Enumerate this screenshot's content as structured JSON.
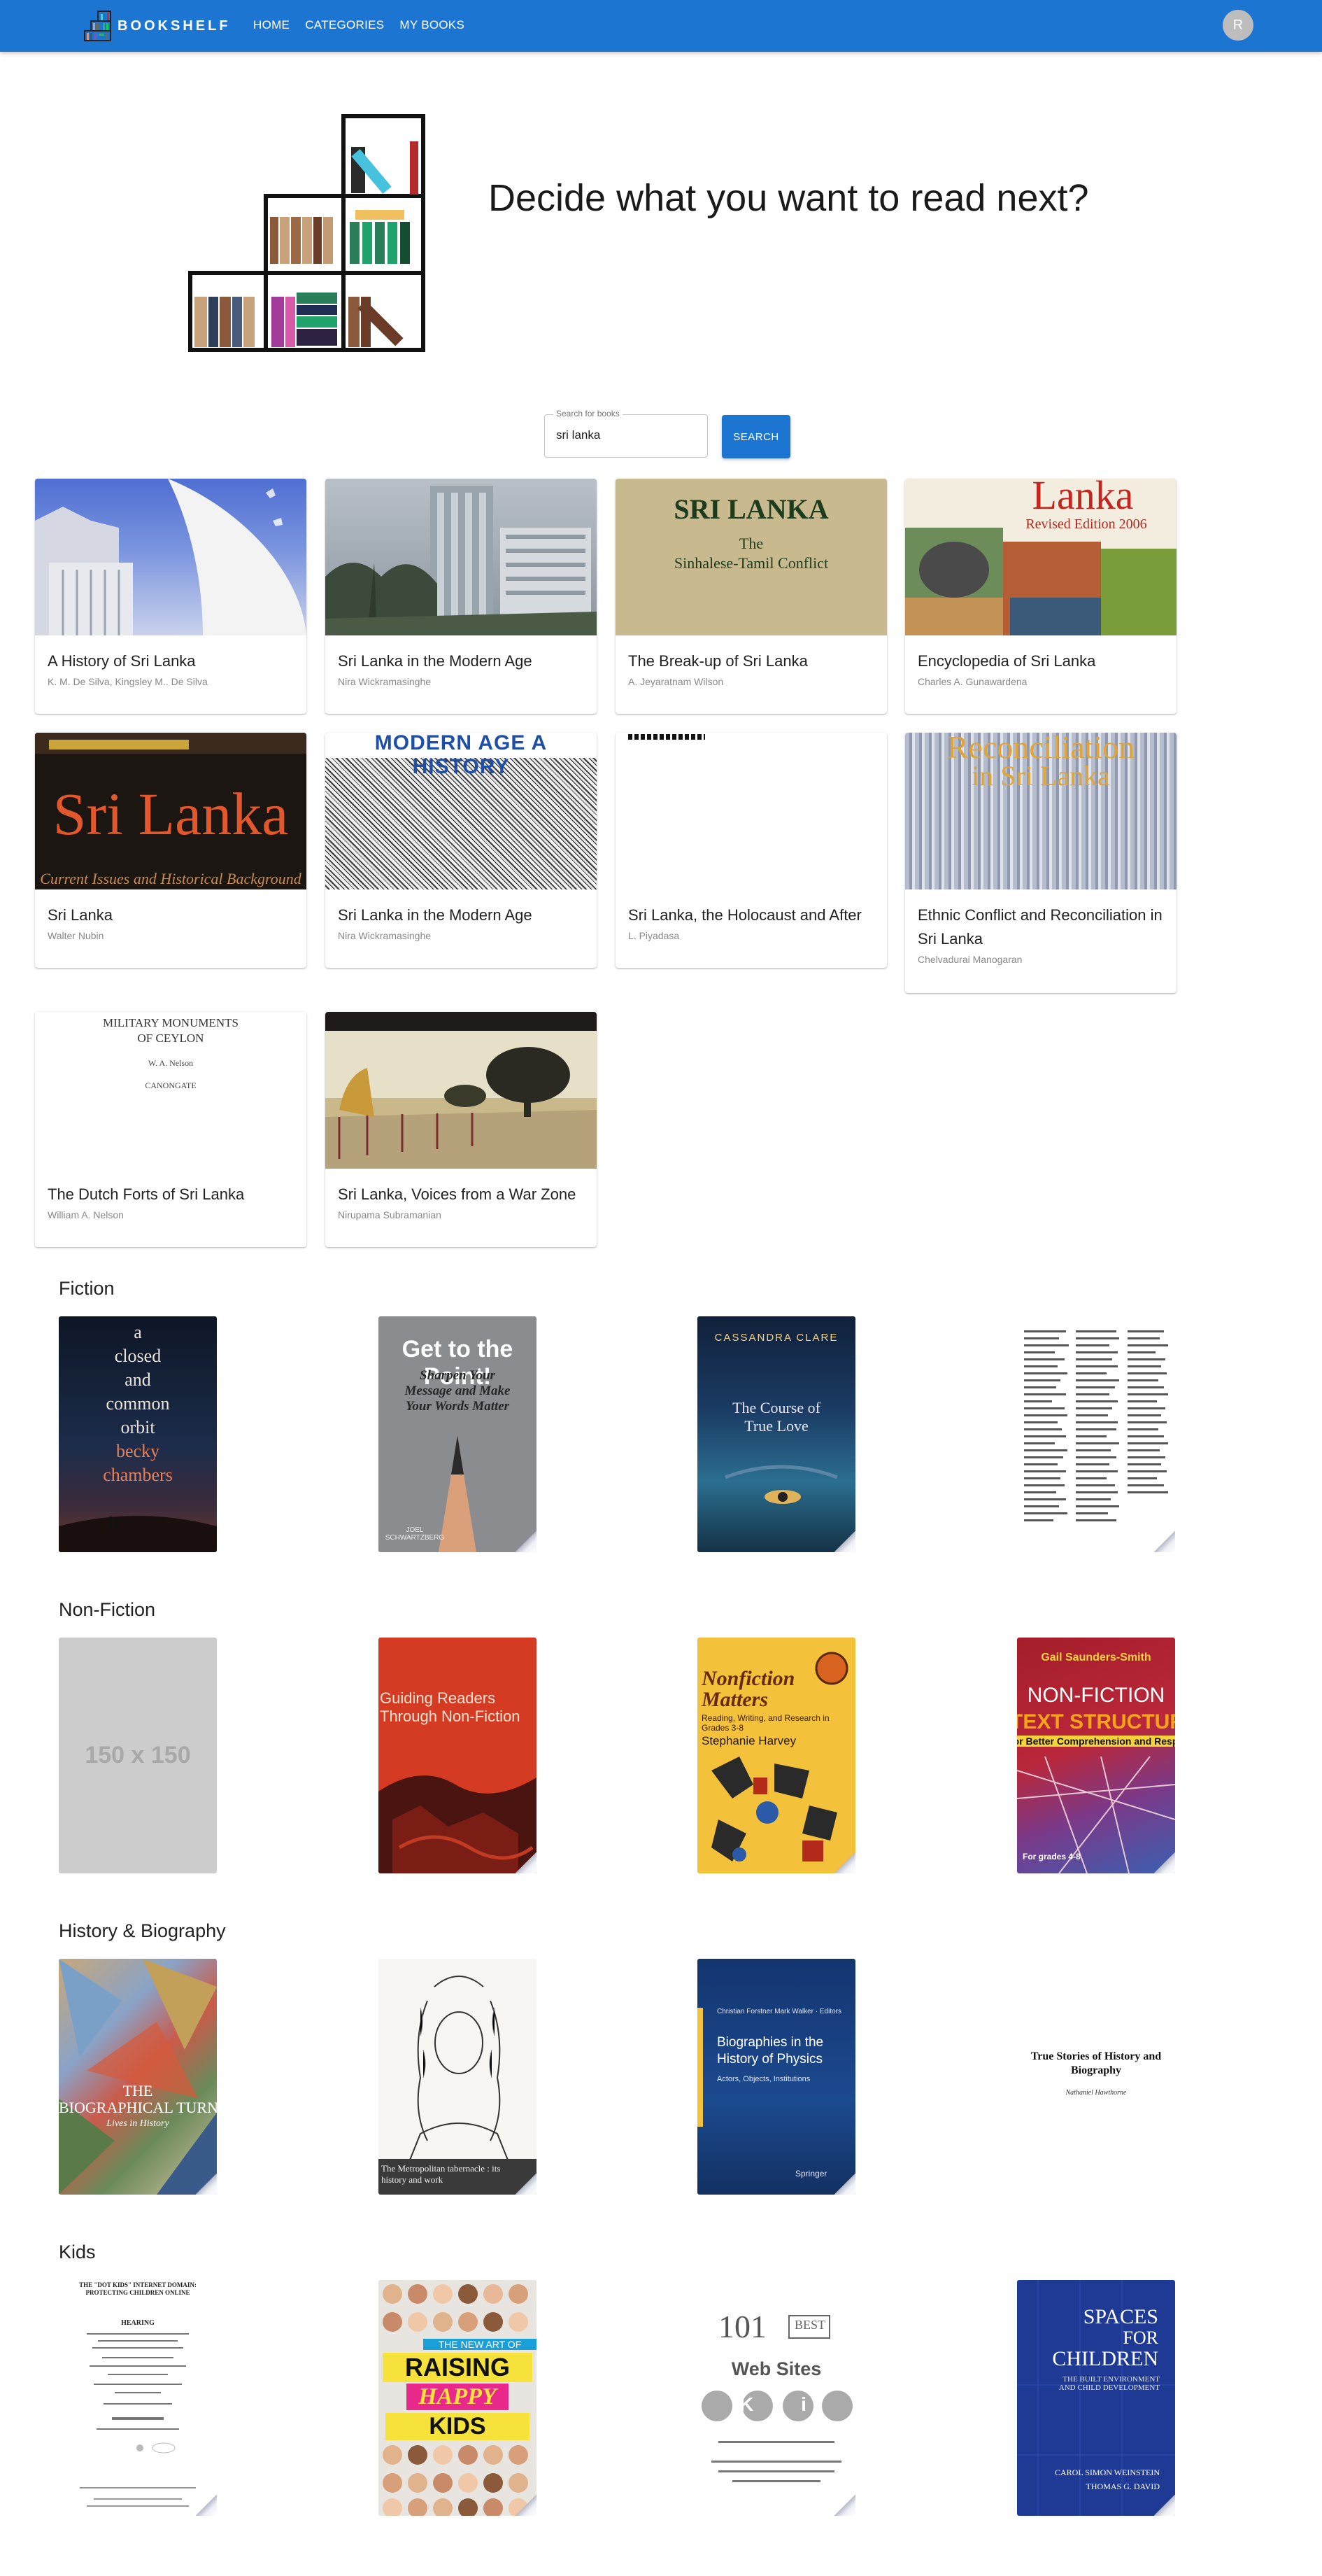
{
  "app": {
    "brand": "BOOKSHELF",
    "nav": [
      "HOME",
      "CATEGORIES",
      "MY BOOKS"
    ],
    "avatar_letter": "R",
    "accent_color": "#1d75d2"
  },
  "hero": {
    "title": "Decide what you want to read next?"
  },
  "search": {
    "label": "Search for books",
    "value": "sri lanka",
    "button": "SEARCH"
  },
  "results": [
    {
      "title": "A History of Sri Lanka",
      "author": "K. M. De Silva, Kingsley M.. De Silva"
    },
    {
      "title": "Sri Lanka in the Modern Age",
      "author": "Nira Wickramasinghe"
    },
    {
      "title": "The Break-up of Sri Lanka",
      "author": "A. Jeyaratnam Wilson",
      "cover_text": [
        "SRI LANKA",
        "The",
        "Sinhalese-Tamil Conflict"
      ]
    },
    {
      "title": "Encyclopedia of Sri Lanka",
      "author": "Charles A. Gunawardena",
      "cover_text": [
        "Lanka",
        "Revised Edition 2006"
      ]
    },
    {
      "title": "Sri Lanka",
      "author": "Walter Nubin",
      "cover_text": [
        "Sri Lanka",
        "Current Issues and Historical Background"
      ]
    },
    {
      "title": "Sri Lanka in the Modern Age",
      "author": "Nira Wickramasinghe",
      "cover_text": [
        "MODERN AGE A HISTORY"
      ]
    },
    {
      "title": "Sri Lanka, the Holocaust and After",
      "author": "L. Piyadasa"
    },
    {
      "title": "Ethnic Conflict and Reconciliation in Sri Lanka",
      "author": "Chelvadurai Manogaran",
      "cover_text": [
        "Reconciliation",
        "in Sri Lanka"
      ]
    },
    {
      "title": "The Dutch Forts of Sri Lanka",
      "author": "William A. Nelson",
      "cover_text": [
        "MILITARY MONUMENTS",
        "OF CEYLON",
        "W. A. Nelson",
        "CANONGATE"
      ]
    },
    {
      "title": "Sri Lanka, Voices from a War Zone",
      "author": "Nirupama Subramanian"
    }
  ],
  "sections": [
    {
      "title": "Fiction",
      "books": [
        {
          "cover_text": [
            "a",
            "closed",
            "and",
            "common",
            "orbit",
            "becky",
            "chambers"
          ]
        },
        {
          "cover_text": [
            "Get to the Point!",
            "Sharpen Your Message and Make Your Words Matter",
            "JOEL SCHWARTZBERG"
          ]
        },
        {
          "cover_text": [
            "CASSANDRA CLARE",
            "The Course of True Love"
          ]
        },
        {
          "cover_text": []
        }
      ]
    },
    {
      "title": "Non-Fiction",
      "books": [
        {
          "cover_text": [
            "150 x 150"
          ]
        },
        {
          "cover_text": [
            "Guiding Readers Through Non-Fiction"
          ]
        },
        {
          "cover_text": [
            "Nonfiction Matters",
            "Reading, Writing, and Research in Grades 3-8",
            "Stephanie Harvey"
          ]
        },
        {
          "cover_text": [
            "Gail Saunders-Smith",
            "NON-FICTION",
            "TEXT STRUCTURES",
            "for Better Comprehension and Response",
            "For grades 4-8"
          ]
        }
      ]
    },
    {
      "title": "History & Biography",
      "books": [
        {
          "cover_text": [
            "THE",
            "BIOGRAPHICAL TURN",
            "Lives in History"
          ]
        },
        {
          "cover_text": [
            "The Metropolitan tabernacle : its history and work"
          ]
        },
        {
          "cover_text": [
            "Christian Forstner  Mark Walker · Editors",
            "Biographies in the History of Physics",
            "Actors, Objects, Institutions",
            "Springer"
          ]
        },
        {
          "cover_text": [
            "True Stories of History and Biography",
            "Nathaniel Hawthorne"
          ]
        }
      ]
    },
    {
      "title": "Kids",
      "books": [
        {
          "cover_text": [
            "THE \"DOT KIDS\" INTERNET DOMAIN: PROTECTING CHILDREN ONLINE",
            "HEARING"
          ]
        },
        {
          "cover_text": [
            "THE NEW ART OF",
            "RAISING",
            "HAPPY",
            "KIDS"
          ]
        },
        {
          "cover_text": [
            "101",
            "BEST",
            "Web Sites",
            "K i d s"
          ]
        },
        {
          "cover_text": [
            "SPACES",
            "FOR",
            "CHILDREN",
            "THE BUILT ENVIRONMENT AND CHILD DEVELOPMENT",
            "CAROL SIMON WEINSTEIN",
            "THOMAS G. DAVID"
          ]
        }
      ]
    }
  ]
}
